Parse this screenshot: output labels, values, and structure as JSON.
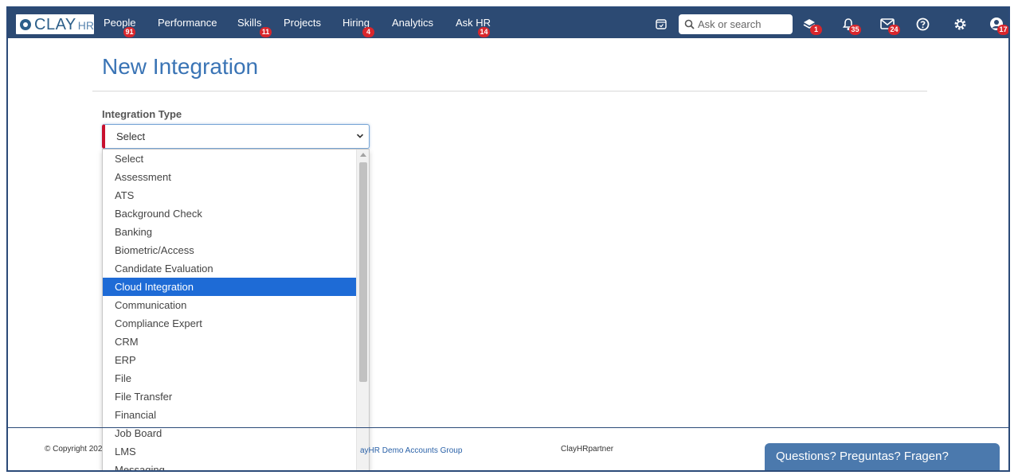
{
  "brand": {
    "logo_main": "CLAY",
    "logo_sub": "HR"
  },
  "nav": [
    {
      "label": "People",
      "badge": "91"
    },
    {
      "label": "Performance",
      "badge": ""
    },
    {
      "label": "Skills",
      "badge": "11"
    },
    {
      "label": "Projects",
      "badge": ""
    },
    {
      "label": "Hiring",
      "badge": "4"
    },
    {
      "label": "Analytics",
      "badge": ""
    },
    {
      "label": "Ask HR",
      "badge": "14"
    }
  ],
  "search": {
    "placeholder": "Ask or search"
  },
  "toolbar_badges": {
    "tasks": "1",
    "notifications": "35",
    "messages": "24",
    "profile": "17"
  },
  "page": {
    "title": "New Integration"
  },
  "form": {
    "integration_type_label": "Integration Type",
    "selected_value": "Select",
    "options": [
      "Select",
      "Assessment",
      "ATS",
      "Background Check",
      "Banking",
      "Biometric/Access",
      "Candidate Evaluation",
      "Cloud Integration",
      "Communication",
      "Compliance Expert",
      "CRM",
      "ERP",
      "File",
      "File Transfer",
      "Financial",
      "Job Board",
      "LMS",
      "Messaging"
    ],
    "highlighted_option": "Cloud Integration"
  },
  "footer": {
    "copyright": "© Copyright 202",
    "group_link": "ayHR Demo Accounts Group",
    "partner": "ClayHRpartner",
    "chat_label": "Questions? Preguntas? Fragen?"
  },
  "colors": {
    "topbar": "#2c4a73",
    "accent": "#3a74b5",
    "badge": "#d9262c",
    "selection": "#1e6bd6",
    "required": "#c8102e"
  }
}
